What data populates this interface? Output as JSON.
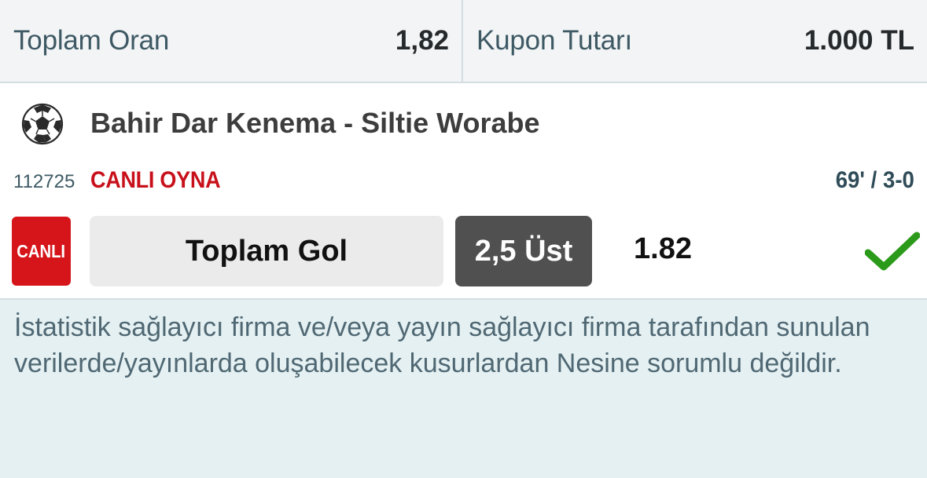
{
  "summary": {
    "total_odds_label": "Toplam Oran",
    "total_odds_value": "1,82",
    "coupon_amount_label": "Kupon Tutarı",
    "coupon_amount_value": "1.000 TL"
  },
  "match": {
    "sport_icon": "soccer-ball-icon",
    "title": "Bahir Dar Kenema - Siltie Worabe",
    "code": "112725",
    "live_link": "CANLI OYNA",
    "live_status": "69' / 3-0",
    "badge": "CANLI",
    "badge_color": "#d6151a",
    "market": "Toplam Gol",
    "selection": "2,5 Üst",
    "odd": "1.82",
    "result_icon": "check-icon",
    "result_color": "#2b9a1a"
  },
  "disclaimer": "İstatistik sağlayıcı firma ve/veya yayın sağlayıcı firma tarafından sunulan verilerde/yayınlarda oluşabilecek kusurlardan Nesine sorumlu değildir."
}
